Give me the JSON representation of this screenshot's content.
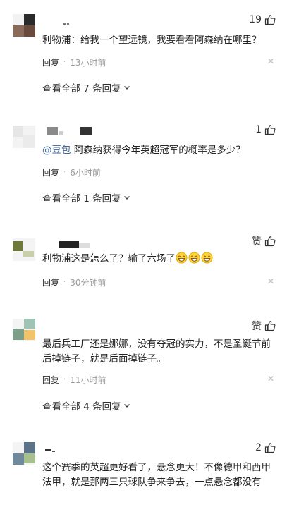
{
  "comments": [
    {
      "likes": "19",
      "text": "利物浦：给我一个望远镜，我要看看阿森纳在哪里？",
      "reply_label": "回复",
      "time": "13小时前",
      "more_replies": "查看全部 7 条回复"
    },
    {
      "likes": "1",
      "mention": "@豆包",
      "text": "阿森纳获得今年英超冠军的概率是多少？",
      "reply_label": "回复",
      "time": "6小时前",
      "more_replies": "查看全部 1 条回复"
    },
    {
      "likes": "赞",
      "text": "利物浦这是怎么了？输了六场了",
      "reply_label": "回复",
      "time": "30分钟前"
    },
    {
      "likes": "赞",
      "text": "最后兵工厂还是娜娜，没有夺冠的实力，不是圣诞节前后掉链子，就是后面掉链子。",
      "reply_label": "回复",
      "time": "11小时前",
      "more_replies": "查看全部 4 条回复"
    },
    {
      "likes": "2",
      "text": "这个赛季的英超更好看了，悬念更大！不像德甲和西甲法甲，就是那两三只球队争来争去，一点悬念都没有"
    }
  ],
  "icons": {
    "like": "thumbs-up-icon",
    "close": "close-icon",
    "chevron": "chevron-down-icon",
    "emoji": "grinning-face-icon"
  },
  "colors": {
    "mention": "#406599",
    "time": "#999999"
  }
}
